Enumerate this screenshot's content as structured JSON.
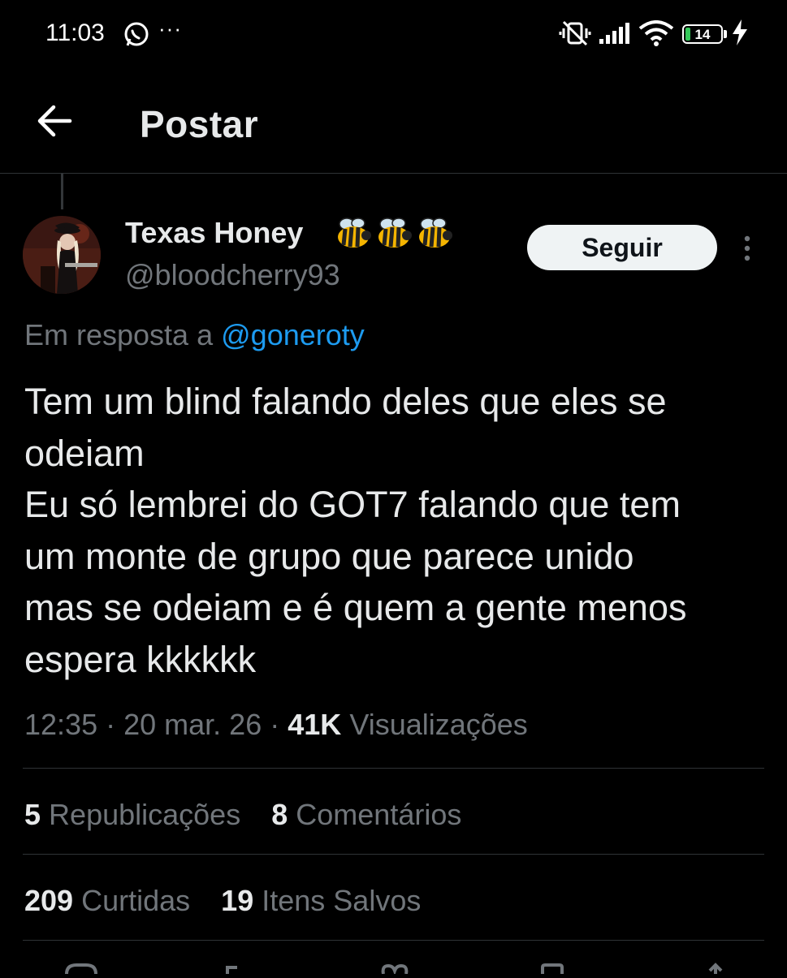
{
  "status_bar": {
    "time": "11:03",
    "overflow_dots": "···",
    "battery_level": "14",
    "battery_percent": 14
  },
  "header": {
    "title": "Postar"
  },
  "post": {
    "author": {
      "display_name": "Texas Honey",
      "name_emoji": "🐝🐝🐝",
      "handle": "@bloodcherry93"
    },
    "follow_label": "Seguir",
    "reply_prefix": "Em resposta a",
    "reply_to": "@goneroty",
    "text_lines": [
      "Tem um blind falando deles que eles se",
      "odeiam",
      "Eu só lembrei do GOT7 falando que tem",
      "um monte de grupo que parece unido",
      "mas se odeiam e é quem a gente menos",
      "espera kkkkkk"
    ],
    "time": "12:35",
    "separator": "·",
    "date": "20 mar. 26",
    "views_count": "41K",
    "views_label": "Visualizações"
  },
  "stats": {
    "reposts_count": "5",
    "reposts_label": "Republicações",
    "comments_count": "8",
    "comments_label": "Comentários",
    "likes_count": "209",
    "likes_label": "Curtidas",
    "saves_count": "19",
    "saves_label": "Itens Salvos"
  },
  "colors": {
    "background": "#000000",
    "text": "#e7e9ea",
    "muted": "#71767b",
    "link": "#1d9bf0",
    "divider": "#2f3336",
    "battery": "#34c759"
  }
}
